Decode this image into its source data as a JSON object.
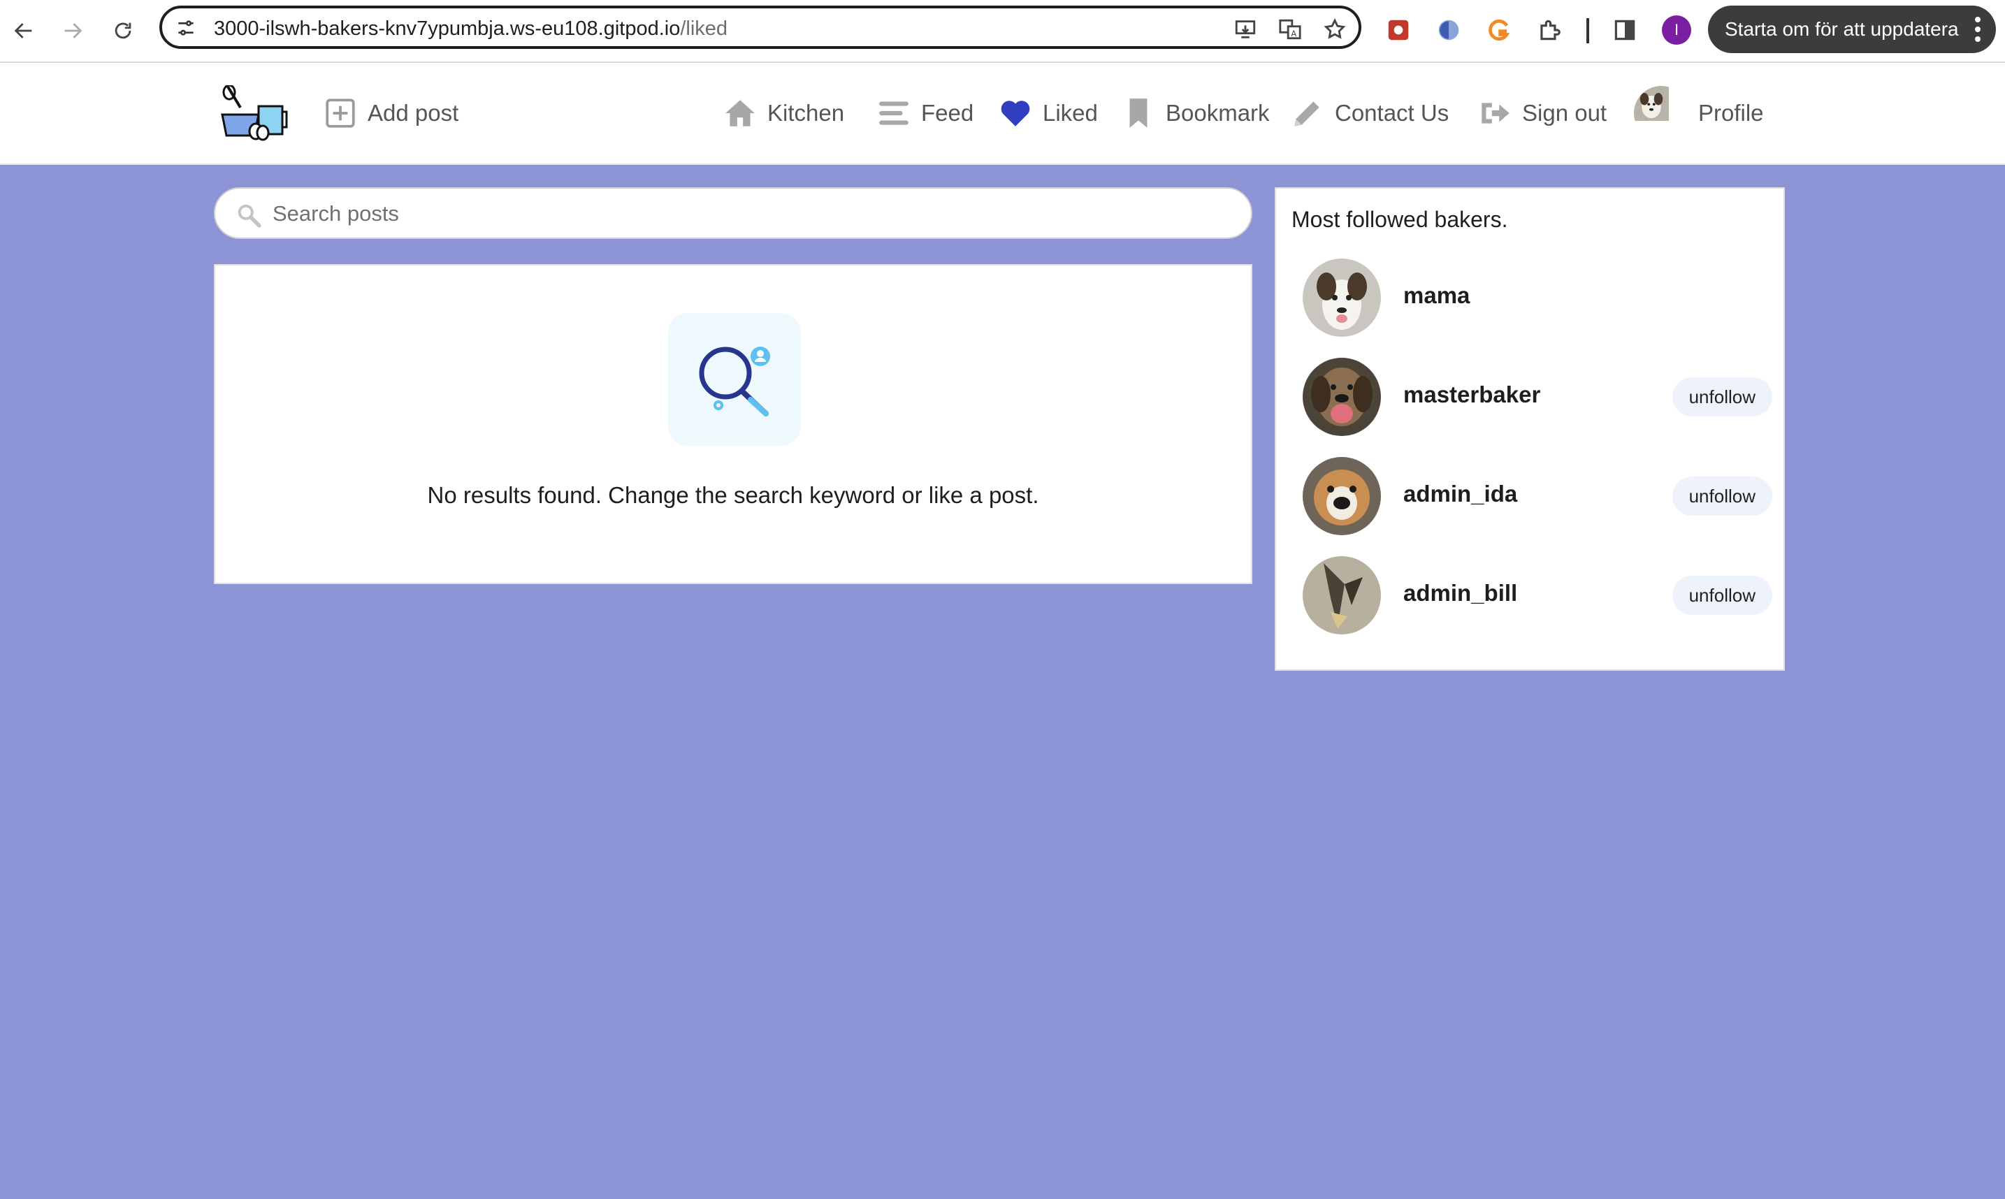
{
  "browser": {
    "url_host": "3000-ilswh-bakers-knv7ypumbja.ws-eu108.gitpod.io",
    "url_path": "/liked",
    "profile_initial": "I",
    "update_label": "Starta om för att uppdatera"
  },
  "nav": {
    "add_post": "Add post",
    "kitchen": "Kitchen",
    "feed": "Feed",
    "liked": "Liked",
    "bookmark": "Bookmark",
    "contact": "Contact Us",
    "sign_out": "Sign out",
    "profile": "Profile",
    "active_color": "#2f3fbf"
  },
  "search": {
    "placeholder": "Search posts"
  },
  "results": {
    "empty_message": "No results found. Change the search keyword or like a post."
  },
  "sidebar": {
    "title": "Most followed bakers.",
    "bakers": [
      {
        "name": "mama",
        "action": ""
      },
      {
        "name": "masterbaker",
        "action": "unfollow"
      },
      {
        "name": "admin_ida",
        "action": "unfollow"
      },
      {
        "name": "admin_bill",
        "action": "unfollow"
      }
    ]
  },
  "colors": {
    "background": "#8c94d6",
    "accent": "#2f3fbf"
  }
}
